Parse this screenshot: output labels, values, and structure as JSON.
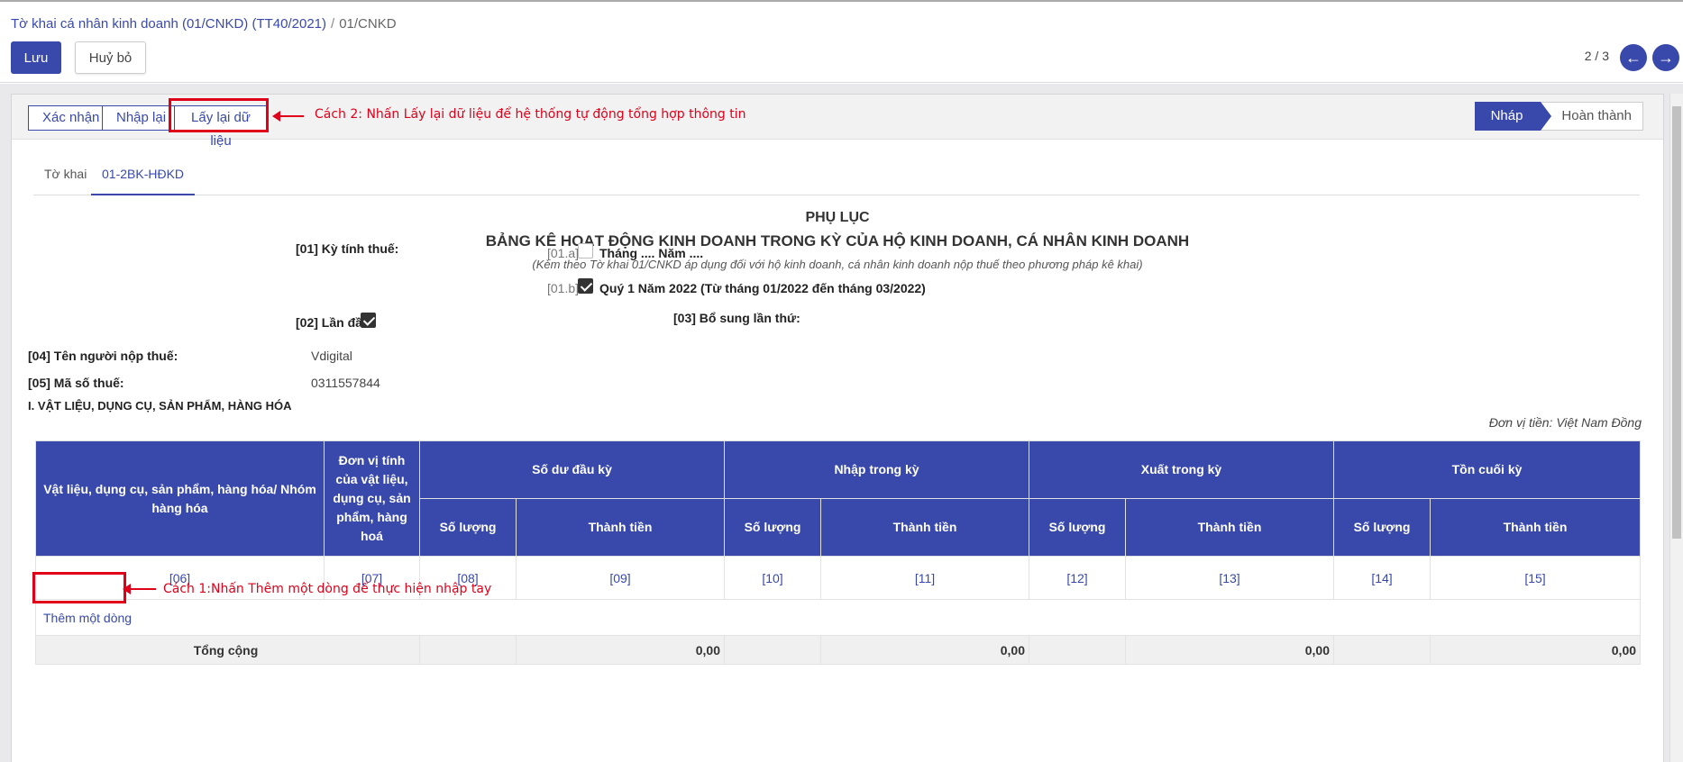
{
  "breadcrumb": {
    "parent": "Tờ khai cá nhân kinh doanh (01/CNKD) (TT40/2021)",
    "sep": "/",
    "current": "01/CNKD"
  },
  "toolbar": {
    "save_label": "Lưu",
    "discard_label": "Huỷ bỏ"
  },
  "pager": {
    "text": "2 / 3",
    "prev_icon": "arrow-left-icon",
    "next_icon": "arrow-right-icon"
  },
  "statusbar": {
    "confirm_label": "Xác nhận",
    "reenter_label": "Nhập lại",
    "refetch_label": "Lấy lại dữ liệu",
    "note2": "Cách 2: Nhấn Lấy lại dữ liệu để hệ thống tự động tổng hợp thông tin",
    "states": [
      "Nháp",
      "Hoàn thành"
    ],
    "active_state": "Nháp"
  },
  "tabs": [
    "Tờ khai",
    "01-2BK-HĐKD"
  ],
  "active_tab": "01-2BK-HĐKD",
  "heading": {
    "title": "PHỤ LỤC",
    "subtitle": "BẢNG KÊ HOẠT ĐỘNG KINH DOANH TRONG KỲ CỦA HỘ KINH DOANH, CÁ NHÂN KINH DOANH",
    "note": "(Kèm theo Tờ khai 01/CNKD áp dụng đối với hộ kinh doanh, cá nhân kinh doanh nộp thuế theo phương pháp kê khai)"
  },
  "form": {
    "period_label": "[01] Kỳ tính thuế:",
    "period_a_code": "[01.a]",
    "period_a_text": "Tháng .... Năm ....",
    "period_a_checked": false,
    "period_b_code": "[01.b]",
    "period_b_text": "Quý 1 Năm 2022 (Từ tháng 01/2022 đến tháng 03/2022)",
    "period_b_checked": true,
    "first_label": "[02] Lần đầu:",
    "first_checked": true,
    "supp_label": "[03] Bổ sung lần thứ:",
    "name_label": "[04] Tên người nộp thuế:",
    "name_value": "Vdigital",
    "tax_label": "[05] Mã số thuế:",
    "tax_value": "0311557844",
    "section_title": "I. VẬT LIỆU, DỤNG CỤ, SẢN PHẨM, HÀNG HÓA",
    "unit_note": "Đơn vị tiền: Việt Nam Đồng"
  },
  "table": {
    "col_item": "Vật liệu, dụng cụ, sản phẩm, hàng hóa/ Nhóm hàng hóa",
    "col_unit": "Đơn vị tính của vật liệu, dụng cụ, sản phẩm, hàng hoá",
    "groups": [
      "Số dư đầu kỳ",
      "Nhập trong kỳ",
      "Xuất trong kỳ",
      "Tồn cuối kỳ"
    ],
    "sub_qty": "Số lượng",
    "sub_amt": "Thành tiền",
    "codes": [
      "[06]",
      "[07]",
      "[08]",
      "[09]",
      "[10]",
      "[11]",
      "[12]",
      "[13]",
      "[14]",
      "[15]"
    ],
    "add_row_label": "Thêm một dòng",
    "note1": "Cách 1:Nhấn Thêm một dòng để thực hiện nhập tay",
    "total_label": "Tổng cộng",
    "totals": [
      "0,00",
      "0,00",
      "0,00",
      "0,00"
    ]
  },
  "colors": {
    "primary": "#3949ab",
    "annotation": "#e0001a"
  }
}
